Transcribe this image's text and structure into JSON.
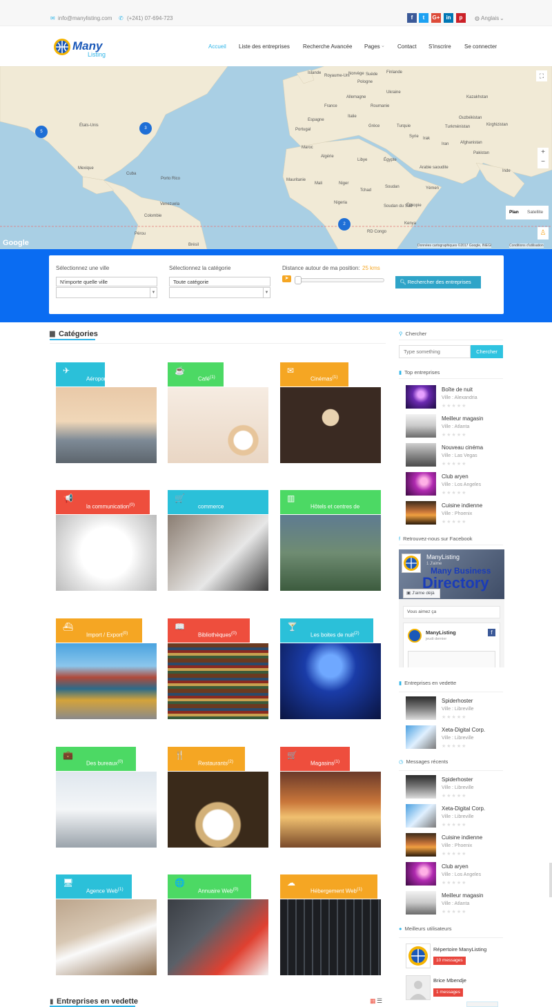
{
  "topbar": {
    "email": "info@manylisting.com",
    "phone": "(+241) 07-694-723",
    "language": "Anglais"
  },
  "nav": {
    "logo": "Many Listing",
    "items": [
      "Accueil",
      "Liste des entreprises",
      "Recherche Avancée",
      "Pages",
      "Contact",
      "S'inscrire",
      "Se connecter"
    ]
  },
  "map": {
    "countries": [
      "Islande",
      "Royaume-Uni",
      "Norvège",
      "Suède",
      "Finlande",
      "Pologne",
      "Ukraine",
      "Roumanie",
      "Kazakhstan",
      "Espagne",
      "France",
      "Allemagne",
      "Italie",
      "Turquie",
      "Grèce",
      "Turkménistan",
      "Ouzbékistan",
      "Kirghizistan",
      "Portugal",
      "Syrie",
      "Irak",
      "Iran",
      "Afghanistan",
      "Pakistan",
      "Inde",
      "Maroc",
      "Algérie",
      "Libye",
      "Égypte",
      "Arabie saoudite",
      "Mauritanie",
      "Mali",
      "Niger",
      "Tchad",
      "Soudan",
      "Yémen",
      "Éthiopie",
      "Nigeria",
      "Soudan du Sud",
      "Kenya",
      "RD Congo",
      "États-Unis",
      "Mexique",
      "Cuba",
      "Porto Rico",
      "Venezuela",
      "Colombie",
      "Pérou",
      "Brésil"
    ],
    "cluster_counts": [
      "5",
      "3",
      "2"
    ],
    "type_buttons": [
      "Plan",
      "Satellite"
    ],
    "google": "Google",
    "attribution": "Données cartographiques ©2017 Google, INEGI",
    "terms": "Conditions d'utilisation"
  },
  "search": {
    "city_label": "Sélectionnez une ville",
    "city_value": "N'importe quelle ville",
    "cat_label": "Sélectionnez la catégorie",
    "cat_value": "Toute catégorie",
    "distance_label": "Distance autour de ma position:",
    "distance_value": "25 kms",
    "button": "Rechercher des entreprises"
  },
  "categories": {
    "title": "Catégories",
    "items": [
      {
        "name": "Aéroport",
        "count": "(1)",
        "color": "#2bc0d9",
        "icon": "✈"
      },
      {
        "name": "Café",
        "count": "(1)",
        "color": "#4cd964",
        "icon": "☕"
      },
      {
        "name": "Cinémas",
        "count": "(1)",
        "color": "#f5a623",
        "icon": "✉"
      },
      {
        "name": "la communication",
        "count": "(0)",
        "color": "#ee4e3d",
        "icon": "📢"
      },
      {
        "name": "commerce",
        "count": "",
        "color": "#2bc0d9",
        "icon": "🛒"
      },
      {
        "name": "Hôtels et centres de",
        "count": "",
        "color": "#4cd964",
        "icon": "▥"
      },
      {
        "name": "Import / Export",
        "count": "(0)",
        "color": "#f5a623",
        "icon": "⛴"
      },
      {
        "name": "Bibliothèques",
        "count": "(0)",
        "color": "#ee4e3d",
        "icon": "📖"
      },
      {
        "name": "Les boites de nuit",
        "count": "(2)",
        "color": "#2bc0d9",
        "icon": "🍸"
      },
      {
        "name": "Des bureaux",
        "count": "(0)",
        "color": "#4cd964",
        "icon": "💼"
      },
      {
        "name": "Restaurants",
        "count": "(2)",
        "color": "#f5a623",
        "icon": "🍴"
      },
      {
        "name": "Magasins",
        "count": "(1)",
        "color": "#ee4e3d",
        "icon": "🛒"
      },
      {
        "name": "Agence Web",
        "count": "(1)",
        "color": "#2bc0d9",
        "icon": "🖥"
      },
      {
        "name": "Annuaire Web",
        "count": "(0)",
        "color": "#4cd964",
        "icon": "🌐"
      },
      {
        "name": "Hébergement Web",
        "count": "(1)",
        "color": "#f5a623",
        "icon": "☁"
      }
    ]
  },
  "featured_title": "Entreprises en vedette",
  "sidebar": {
    "search_title": "Chercher",
    "search_placeholder": "Type something",
    "search_button": "Chercher",
    "top_title": "Top entreprises",
    "top": [
      {
        "name": "Boîte de nuit",
        "city": "Alexandria"
      },
      {
        "name": "Meilleur magasin",
        "city": "Atlanta"
      },
      {
        "name": "Nouveau cinéma",
        "city": "Las Vegas"
      },
      {
        "name": "Club aryen",
        "city": "Los Angeles"
      },
      {
        "name": "Cuisine indienne",
        "city": "Phoenix"
      }
    ],
    "city_prefix": "Ville : ",
    "fb_title": "Retrouvez-nous sur Facebook",
    "fb_page": "ManyListing",
    "fb_likes": "1 J'aime",
    "fb_cover1": "Many Business",
    "fb_cover2": "Directory",
    "fb_like_btn": "J'aime déjà",
    "fb_q": "Vous aimez ça",
    "fb_post_name": "ManyListing",
    "fb_post_date": "jeudi dernier",
    "feat_title": "Entreprises en vedette",
    "feat": [
      {
        "name": "Spiderhoster",
        "city": "Libreville"
      },
      {
        "name": "Xeta-Digital Corp.",
        "city": "Libreville"
      }
    ],
    "recent_title": "Messages récents",
    "recent": [
      {
        "name": "Spiderhoster",
        "city": "Libreville"
      },
      {
        "name": "Xeta-Digital Corp.",
        "city": "Libreville"
      },
      {
        "name": "Cuisine indienne",
        "city": "Phoenix"
      },
      {
        "name": "Club aryen",
        "city": "Los Angeles"
      },
      {
        "name": "Meilleur magasin",
        "city": "Atlanta"
      }
    ],
    "users_title": "Meilleurs utilisateurs",
    "users": [
      {
        "name": "Répertoire ManyListing",
        "badge": "10 messages"
      },
      {
        "name": "Brice Mbendje",
        "badge": "1 messages"
      }
    ]
  }
}
